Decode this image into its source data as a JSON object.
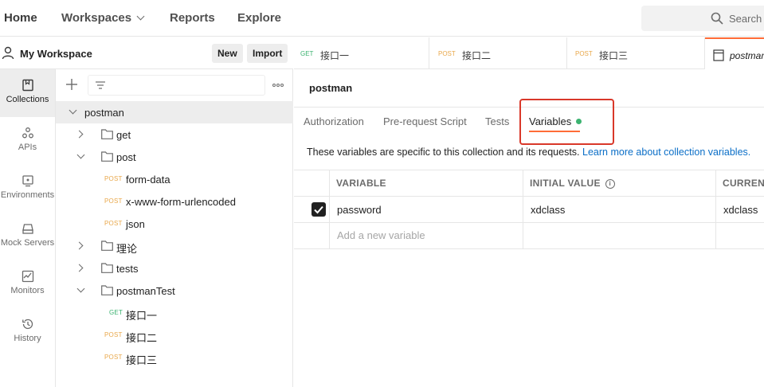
{
  "topbar": {
    "home": "Home",
    "workspaces": "Workspaces",
    "reports": "Reports",
    "explore": "Explore",
    "search_placeholder": "Search P"
  },
  "workspace": {
    "name": "My Workspace",
    "new_label": "New",
    "import_label": "Import"
  },
  "rail": {
    "items": [
      {
        "label": "Collections",
        "icon": "collections-icon"
      },
      {
        "label": "APIs",
        "icon": "apis-icon"
      },
      {
        "label": "Environments",
        "icon": "environments-icon"
      },
      {
        "label": "Mock Servers",
        "icon": "mock-servers-icon"
      },
      {
        "label": "Monitors",
        "icon": "monitors-icon"
      },
      {
        "label": "History",
        "icon": "history-icon"
      }
    ]
  },
  "tree": {
    "collection": "postman",
    "folders": {
      "get": "get",
      "post": "post",
      "theory": "理论",
      "tests": "tests",
      "postmanTest": "postmanTest"
    },
    "post_requests": [
      {
        "method": "POST",
        "name": "form-data"
      },
      {
        "method": "POST",
        "name": "x-www-form-urlencoded"
      },
      {
        "method": "POST",
        "name": "json"
      }
    ],
    "postmanTest_requests": [
      {
        "method": "GET",
        "name": "接口一"
      },
      {
        "method": "POST",
        "name": "接口二"
      },
      {
        "method": "POST",
        "name": "接口三"
      }
    ]
  },
  "tabs": [
    {
      "method": "GET",
      "name": "接口一"
    },
    {
      "method": "POST",
      "name": "接口二"
    },
    {
      "method": "POST",
      "name": "接口三"
    },
    {
      "method": "",
      "name": "postman"
    }
  ],
  "main": {
    "title": "postman",
    "subtabs": [
      "Authorization",
      "Pre-request Script",
      "Tests",
      "Variables"
    ],
    "info": "These variables are specific to this collection and its requests.",
    "info_link": "Learn more about collection variables.",
    "table": {
      "headers": [
        "VARIABLE",
        "INITIAL VALUE",
        "CURRENT"
      ],
      "rows": [
        {
          "checked": true,
          "variable": "password",
          "initial": "xdclass",
          "current": "xdclass"
        }
      ],
      "placeholder": "Add a new variable"
    }
  },
  "colors": {
    "accent": "#ff6c37",
    "get": "#3cb371",
    "post": "#e9a84b",
    "highlight": "#d9382a",
    "link": "#0a6ec7"
  }
}
